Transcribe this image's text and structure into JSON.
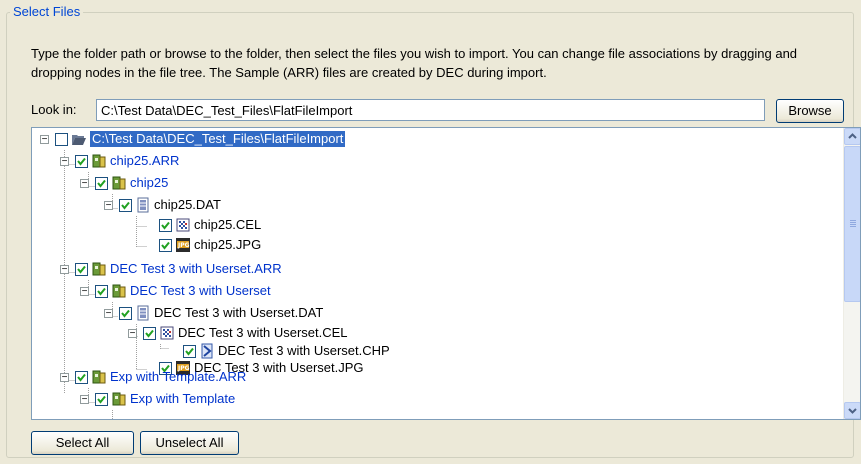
{
  "group_title": "Select Files",
  "description": "Type the folder path or browse to the folder, then select the files you wish to import. You can change file associations by dragging and dropping nodes in the file tree. The Sample (ARR) files are created by DEC during import.",
  "look_in": {
    "label": "Look in:",
    "value": "C:\\Test Data\\DEC_Test_Files\\FlatFileImport"
  },
  "browse_label": "Browse",
  "tree": {
    "nodes": [
      {
        "label": "C:\\Test Data\\DEC_Test_Files\\FlatFileImport",
        "icon": "folder-open-icon",
        "checked": false,
        "blue": false,
        "selected": true
      },
      {
        "label": "chip25.ARR",
        "icon": "sample-icon",
        "checked": true,
        "blue": true
      },
      {
        "label": "chip25",
        "icon": "sample-icon",
        "checked": true,
        "blue": true
      },
      {
        "label": "chip25.DAT",
        "icon": "dat-file-icon",
        "checked": true,
        "blue": false
      },
      {
        "label": "chip25.CEL",
        "icon": "cel-file-icon",
        "checked": true,
        "blue": false
      },
      {
        "label": "chip25.JPG",
        "icon": "jpg-file-icon",
        "checked": true,
        "blue": false
      },
      {
        "label": "DEC Test 3 with Userset.ARR",
        "icon": "sample-icon",
        "checked": true,
        "blue": true
      },
      {
        "label": "DEC Test 3 with Userset",
        "icon": "sample-icon",
        "checked": true,
        "blue": true
      },
      {
        "label": "DEC Test 3 with Userset.DAT",
        "icon": "dat-file-icon",
        "checked": true,
        "blue": false
      },
      {
        "label": "DEC Test 3 with Userset.CEL",
        "icon": "cel-file-icon",
        "checked": true,
        "blue": false
      },
      {
        "label": "DEC Test 3 with Userset.CHP",
        "icon": "chp-file-icon",
        "checked": true,
        "blue": false
      },
      {
        "label": "DEC Test 3 with Userset.JPG",
        "icon": "jpg-file-icon",
        "checked": true,
        "blue": false
      },
      {
        "label": "Exp with Template.ARR",
        "icon": "sample-icon",
        "checked": true,
        "blue": true
      },
      {
        "label": "Exp with Template",
        "icon": "sample-icon",
        "checked": true,
        "blue": true
      }
    ]
  },
  "select_all_label": "Select All",
  "unselect_all_label": "Unselect All",
  "colors": {
    "accent": "#316ac5",
    "link_blue": "#0033cc",
    "legend_blue": "#0046d5",
    "background": "#ece9d8"
  }
}
